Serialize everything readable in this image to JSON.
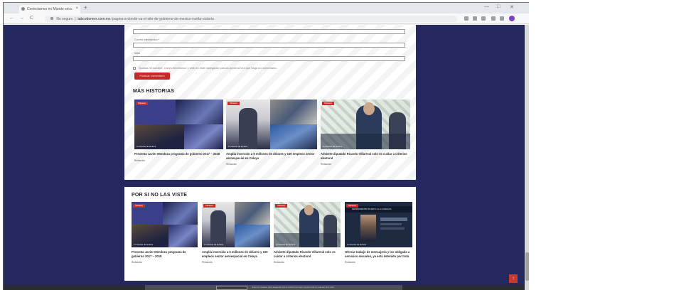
{
  "browser": {
    "tab_title": "Conectamos en Mundo secc",
    "tab_close": "×",
    "new_tab": "+",
    "address_prefix": "No seguro",
    "address_host": "tabcodemex.com.mx",
    "address_path": "/pagina-a-donde-va-el-site-de-gobierno-de-mexico-vuelta-victoria",
    "back": "←",
    "forward": "→",
    "reload": "C",
    "minimize": "—",
    "maximize": "□",
    "close": "✕"
  },
  "form": {
    "label_email": "Correo electrónico *",
    "label_web": "Web",
    "consent_text": "Guarda mi nombre, correo electrónico y web en este navegador para la próxima vez que haga un comentario.",
    "submit_label": "Publicar comentario"
  },
  "mas_historias": {
    "heading": "MÁS HISTORIAS",
    "stories": [
      {
        "badge": "Tabasco",
        "read": "2 minutos de lectura",
        "title": "Presenta Javier Mendoza programa de gobierno 2017 – 2018",
        "author": "Redacción"
      },
      {
        "badge": "Tabasco",
        "read": "2 minutos de lectura",
        "title": "Amplía inversión a 5 millones de dólares y 100 empleos sector aeroespacial en Celaya",
        "author": "Redacción"
      },
      {
        "badge": "Tabasco",
        "read": "2 minutos de lectura",
        "title": "Advierte diputado Ricardo Villarreal solo es cuidar a criterios electoral",
        "author": "Redacción"
      }
    ]
  },
  "por_si_no": {
    "heading": "POR SI NO LAS VISTE",
    "stories": [
      {
        "badge": "Tabasco",
        "read": "2 minutos de lectura",
        "title": "Presenta Javier Mendoza programa de gobierno 2017 – 2018",
        "author": "Redacción"
      },
      {
        "badge": "Tabasco",
        "read": "2 minutos de lectura",
        "title": "Amplía inversión a 5 millones de dólares y 100 empleos sector aeroespacial en Celaya",
        "author": "Redacción"
      },
      {
        "badge": "Tabasco",
        "read": "2 minutos de lectura",
        "title": "Advierte diputado Ricardo Villarreal solo es cuidar a criterios electoral",
        "author": "Redacción"
      },
      {
        "badge": "Tabasco",
        "read": "2 minutos de lectura",
        "overlay": "DEPENDIENTE SUJETO A LA LICENCIA",
        "title": "Ofrecía trabajo de mensajería y los obligaba a servicios sexuales, ya está detenido por trata",
        "author": "Redacción"
      }
    ]
  },
  "cookie": {
    "text": "Usamos cookies para asegurar que te damos la mejor experiencia en nuestro sitio web."
  },
  "back_to_top": "↑",
  "colors": {
    "page_background": "#24285e",
    "accent_red": "#c32a2a",
    "card": "#ffffff"
  }
}
